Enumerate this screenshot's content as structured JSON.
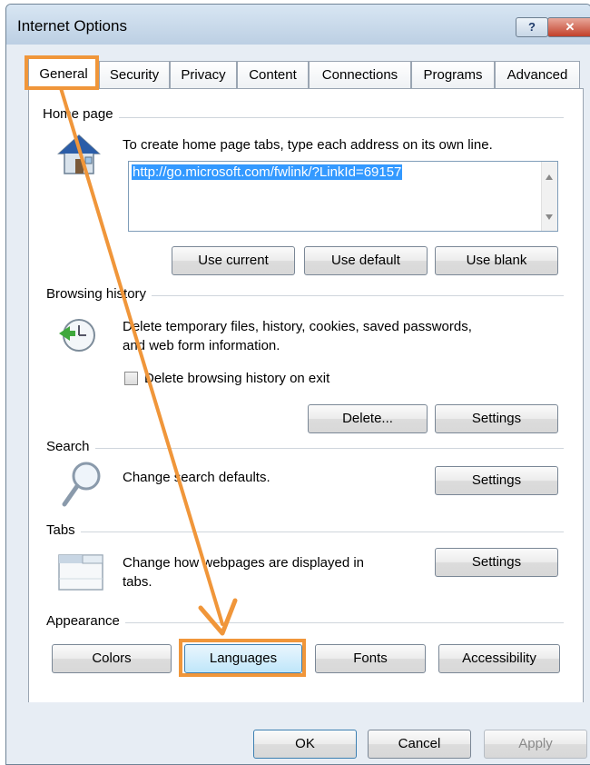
{
  "window": {
    "title": "Internet Options",
    "help_label": "?",
    "close_label": "✕"
  },
  "tabs": [
    "General",
    "Security",
    "Privacy",
    "Content",
    "Connections",
    "Programs",
    "Advanced"
  ],
  "home_page": {
    "label": "Home page",
    "description": "To create home page tabs, type each address on its own line.",
    "url": "http://go.microsoft.com/fwlink/?LinkId=69157",
    "buttons": {
      "use_current": "Use current",
      "use_default": "Use default",
      "use_blank": "Use blank"
    }
  },
  "browsing_history": {
    "label": "Browsing history",
    "description_line1": "Delete temporary files, history, cookies, saved passwords,",
    "description_line2": "and web form information.",
    "checkbox_label": "Delete browsing history on exit",
    "buttons": {
      "delete": "Delete...",
      "settings": "Settings"
    }
  },
  "search": {
    "label": "Search",
    "description": "Change search defaults.",
    "settings": "Settings"
  },
  "tabs_section": {
    "label": "Tabs",
    "description_line1": "Change how webpages are displayed in",
    "description_line2": "tabs.",
    "settings": "Settings"
  },
  "appearance": {
    "label": "Appearance",
    "buttons": {
      "colors": "Colors",
      "languages": "Languages",
      "fonts": "Fonts",
      "accessibility": "Accessibility"
    }
  },
  "footer": {
    "ok": "OK",
    "cancel": "Cancel",
    "apply": "Apply"
  },
  "colors": {
    "annotation": "#f0963a",
    "selection": "#3399ff",
    "title_bar": "#c9dbec"
  },
  "icons": [
    "house-icon",
    "history-clock-icon",
    "magnifier-icon",
    "tabs-window-icon",
    "help-icon",
    "close-icon"
  ]
}
